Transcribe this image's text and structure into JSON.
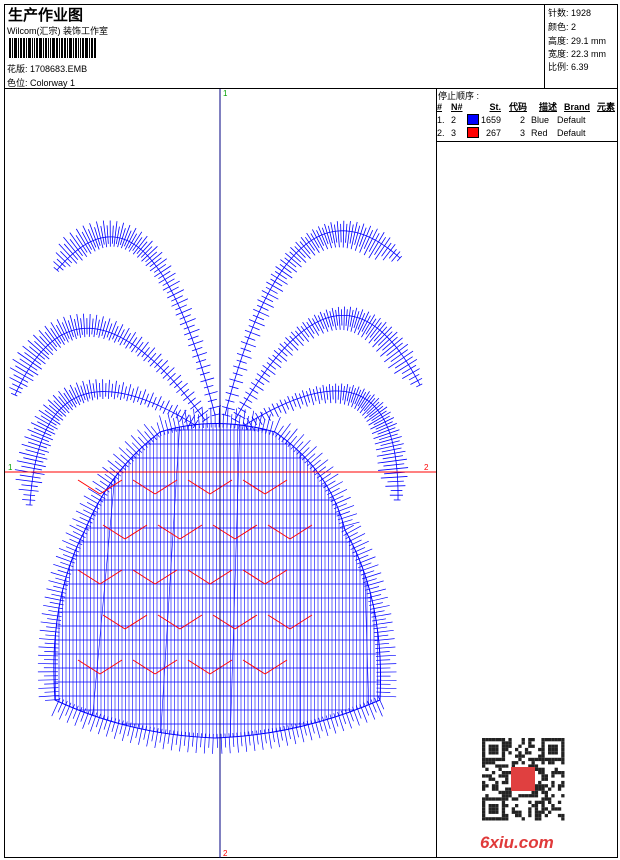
{
  "header": {
    "title": "生产作业图",
    "company": "Wilcom(汇宗) 装饰工作室",
    "design_label": "花版:",
    "design_file": "1708683.EMB",
    "colorway_label": "色位:",
    "colorway": "Colorway 1"
  },
  "info": {
    "stitches": "针数: 1928",
    "colors": "颜色: 2",
    "height": "高度: 29.1 mm",
    "width": "宽度: 22.3 mm",
    "scale": "比例: 6.39"
  },
  "stop_sequence": {
    "title": "停止顺序 :",
    "headers": [
      "#",
      "N#",
      "St.",
      "代码",
      "描述",
      "Brand",
      "元素"
    ],
    "rows": [
      {
        "idx": "1.",
        "n": "2",
        "color": "#0000ff",
        "st": "1659",
        "code": "2",
        "desc": "Blue",
        "brand": "Default"
      },
      {
        "idx": "2.",
        "n": "3",
        "color": "#ff0000",
        "st": "267",
        "code": "3",
        "desc": "Red",
        "brand": "Default"
      }
    ]
  },
  "axes": {
    "top": "1",
    "bottom": "2",
    "left": "1",
    "right": "2"
  },
  "watermark": "6xiu.com",
  "colors": {
    "thread1": "#0000ff",
    "thread2": "#ff0000",
    "axis_v": "#000080",
    "axis_h": "#ff0000"
  }
}
